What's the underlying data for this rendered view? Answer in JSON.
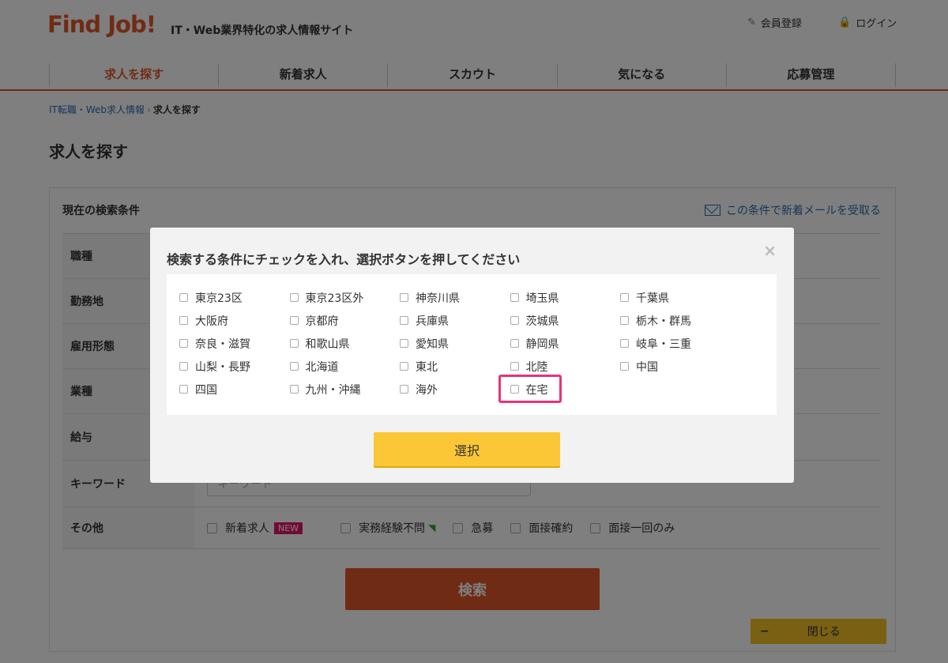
{
  "header": {
    "logo": "Find Job!",
    "tagline": "IT・Web業界特化の求人情報サイト",
    "register_label": "会員登録",
    "login_label": "ログイン"
  },
  "nav": {
    "items": [
      {
        "label": "求人を探す",
        "active": true
      },
      {
        "label": "新着求人"
      },
      {
        "label": "スカウト"
      },
      {
        "label": "気になる"
      },
      {
        "label": "応募管理"
      }
    ]
  },
  "breadcrumb": {
    "link": "IT転職・Web求人情報",
    "current": "求人を探す"
  },
  "page_title": "求人を探す",
  "conditions": {
    "title": "現在の検索条件",
    "mail_link": "この条件で新着メールを受取る",
    "rows": [
      {
        "label": "職種"
      },
      {
        "label": "勤務地"
      },
      {
        "label": "雇用形態"
      },
      {
        "label": "業種"
      },
      {
        "label": "給与"
      },
      {
        "label": "キーワード"
      },
      {
        "label": "その他"
      }
    ],
    "keyword_placeholder": "キーワード",
    "other_options": {
      "new": "新着求人",
      "new_badge": "NEW",
      "no_experience": "実務経験不問",
      "urgent": "急募",
      "interview_confirmed": "面接確約",
      "one_interview": "面接一回のみ"
    },
    "search_button": "検索",
    "close_button": "閉じる"
  },
  "modal": {
    "title": "検索する条件にチェックを入れ、選択ボタンを押してください",
    "close": "×",
    "options": [
      [
        "東京23区",
        "東京23区外",
        "神奈川県",
        "埼玉県",
        "千葉県"
      ],
      [
        "大阪府",
        "京都府",
        "兵庫県",
        "茨城県",
        "栃木・群馬"
      ],
      [
        "奈良・滋賀",
        "和歌山県",
        "愛知県",
        "静岡県",
        "岐阜・三重"
      ],
      [
        "山梨・長野",
        "北海道",
        "東北",
        "北陸",
        "中国"
      ],
      [
        "四国",
        "九州・沖縄",
        "海外",
        "在宅"
      ]
    ],
    "select_button": "選択"
  },
  "colors": {
    "brand": "#e0572b",
    "highlight": "#e8337a",
    "select_button": "#fbc736"
  }
}
